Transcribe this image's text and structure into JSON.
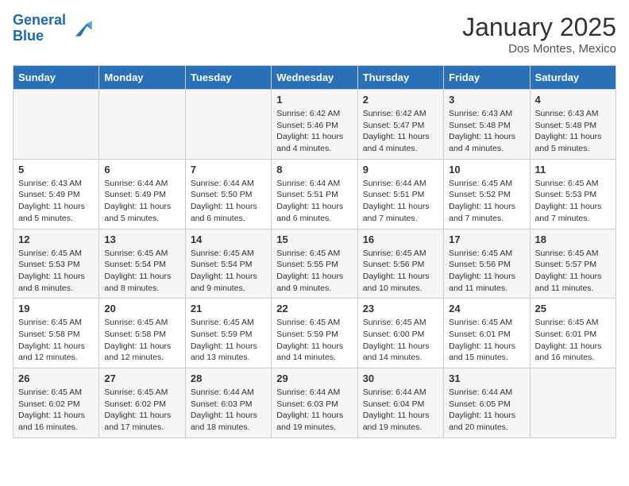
{
  "header": {
    "logo_line1": "General",
    "logo_line2": "Blue",
    "month": "January 2025",
    "location": "Dos Montes, Mexico"
  },
  "days_of_week": [
    "Sunday",
    "Monday",
    "Tuesday",
    "Wednesday",
    "Thursday",
    "Friday",
    "Saturday"
  ],
  "weeks": [
    [
      {
        "day": "",
        "content": ""
      },
      {
        "day": "",
        "content": ""
      },
      {
        "day": "",
        "content": ""
      },
      {
        "day": "1",
        "content": "Sunrise: 6:42 AM\nSunset: 5:46 PM\nDaylight: 11 hours and 4 minutes."
      },
      {
        "day": "2",
        "content": "Sunrise: 6:42 AM\nSunset: 5:47 PM\nDaylight: 11 hours and 4 minutes."
      },
      {
        "day": "3",
        "content": "Sunrise: 6:43 AM\nSunset: 5:48 PM\nDaylight: 11 hours and 4 minutes."
      },
      {
        "day": "4",
        "content": "Sunrise: 6:43 AM\nSunset: 5:48 PM\nDaylight: 11 hours and 5 minutes."
      }
    ],
    [
      {
        "day": "5",
        "content": "Sunrise: 6:43 AM\nSunset: 5:49 PM\nDaylight: 11 hours and 5 minutes."
      },
      {
        "day": "6",
        "content": "Sunrise: 6:44 AM\nSunset: 5:49 PM\nDaylight: 11 hours and 5 minutes."
      },
      {
        "day": "7",
        "content": "Sunrise: 6:44 AM\nSunset: 5:50 PM\nDaylight: 11 hours and 6 minutes."
      },
      {
        "day": "8",
        "content": "Sunrise: 6:44 AM\nSunset: 5:51 PM\nDaylight: 11 hours and 6 minutes."
      },
      {
        "day": "9",
        "content": "Sunrise: 6:44 AM\nSunset: 5:51 PM\nDaylight: 11 hours and 7 minutes."
      },
      {
        "day": "10",
        "content": "Sunrise: 6:45 AM\nSunset: 5:52 PM\nDaylight: 11 hours and 7 minutes."
      },
      {
        "day": "11",
        "content": "Sunrise: 6:45 AM\nSunset: 5:53 PM\nDaylight: 11 hours and 7 minutes."
      }
    ],
    [
      {
        "day": "12",
        "content": "Sunrise: 6:45 AM\nSunset: 5:53 PM\nDaylight: 11 hours and 8 minutes."
      },
      {
        "day": "13",
        "content": "Sunrise: 6:45 AM\nSunset: 5:54 PM\nDaylight: 11 hours and 8 minutes."
      },
      {
        "day": "14",
        "content": "Sunrise: 6:45 AM\nSunset: 5:54 PM\nDaylight: 11 hours and 9 minutes."
      },
      {
        "day": "15",
        "content": "Sunrise: 6:45 AM\nSunset: 5:55 PM\nDaylight: 11 hours and 9 minutes."
      },
      {
        "day": "16",
        "content": "Sunrise: 6:45 AM\nSunset: 5:56 PM\nDaylight: 11 hours and 10 minutes."
      },
      {
        "day": "17",
        "content": "Sunrise: 6:45 AM\nSunset: 5:56 PM\nDaylight: 11 hours and 11 minutes."
      },
      {
        "day": "18",
        "content": "Sunrise: 6:45 AM\nSunset: 5:57 PM\nDaylight: 11 hours and 11 minutes."
      }
    ],
    [
      {
        "day": "19",
        "content": "Sunrise: 6:45 AM\nSunset: 5:58 PM\nDaylight: 11 hours and 12 minutes."
      },
      {
        "day": "20",
        "content": "Sunrise: 6:45 AM\nSunset: 5:58 PM\nDaylight: 11 hours and 12 minutes."
      },
      {
        "day": "21",
        "content": "Sunrise: 6:45 AM\nSunset: 5:59 PM\nDaylight: 11 hours and 13 minutes."
      },
      {
        "day": "22",
        "content": "Sunrise: 6:45 AM\nSunset: 5:59 PM\nDaylight: 11 hours and 14 minutes."
      },
      {
        "day": "23",
        "content": "Sunrise: 6:45 AM\nSunset: 6:00 PM\nDaylight: 11 hours and 14 minutes."
      },
      {
        "day": "24",
        "content": "Sunrise: 6:45 AM\nSunset: 6:01 PM\nDaylight: 11 hours and 15 minutes."
      },
      {
        "day": "25",
        "content": "Sunrise: 6:45 AM\nSunset: 6:01 PM\nDaylight: 11 hours and 16 minutes."
      }
    ],
    [
      {
        "day": "26",
        "content": "Sunrise: 6:45 AM\nSunset: 6:02 PM\nDaylight: 11 hours and 16 minutes."
      },
      {
        "day": "27",
        "content": "Sunrise: 6:45 AM\nSunset: 6:02 PM\nDaylight: 11 hours and 17 minutes."
      },
      {
        "day": "28",
        "content": "Sunrise: 6:44 AM\nSunset: 6:03 PM\nDaylight: 11 hours and 18 minutes."
      },
      {
        "day": "29",
        "content": "Sunrise: 6:44 AM\nSunset: 6:03 PM\nDaylight: 11 hours and 19 minutes."
      },
      {
        "day": "30",
        "content": "Sunrise: 6:44 AM\nSunset: 6:04 PM\nDaylight: 11 hours and 19 minutes."
      },
      {
        "day": "31",
        "content": "Sunrise: 6:44 AM\nSunset: 6:05 PM\nDaylight: 11 hours and 20 minutes."
      },
      {
        "day": "",
        "content": ""
      }
    ]
  ]
}
